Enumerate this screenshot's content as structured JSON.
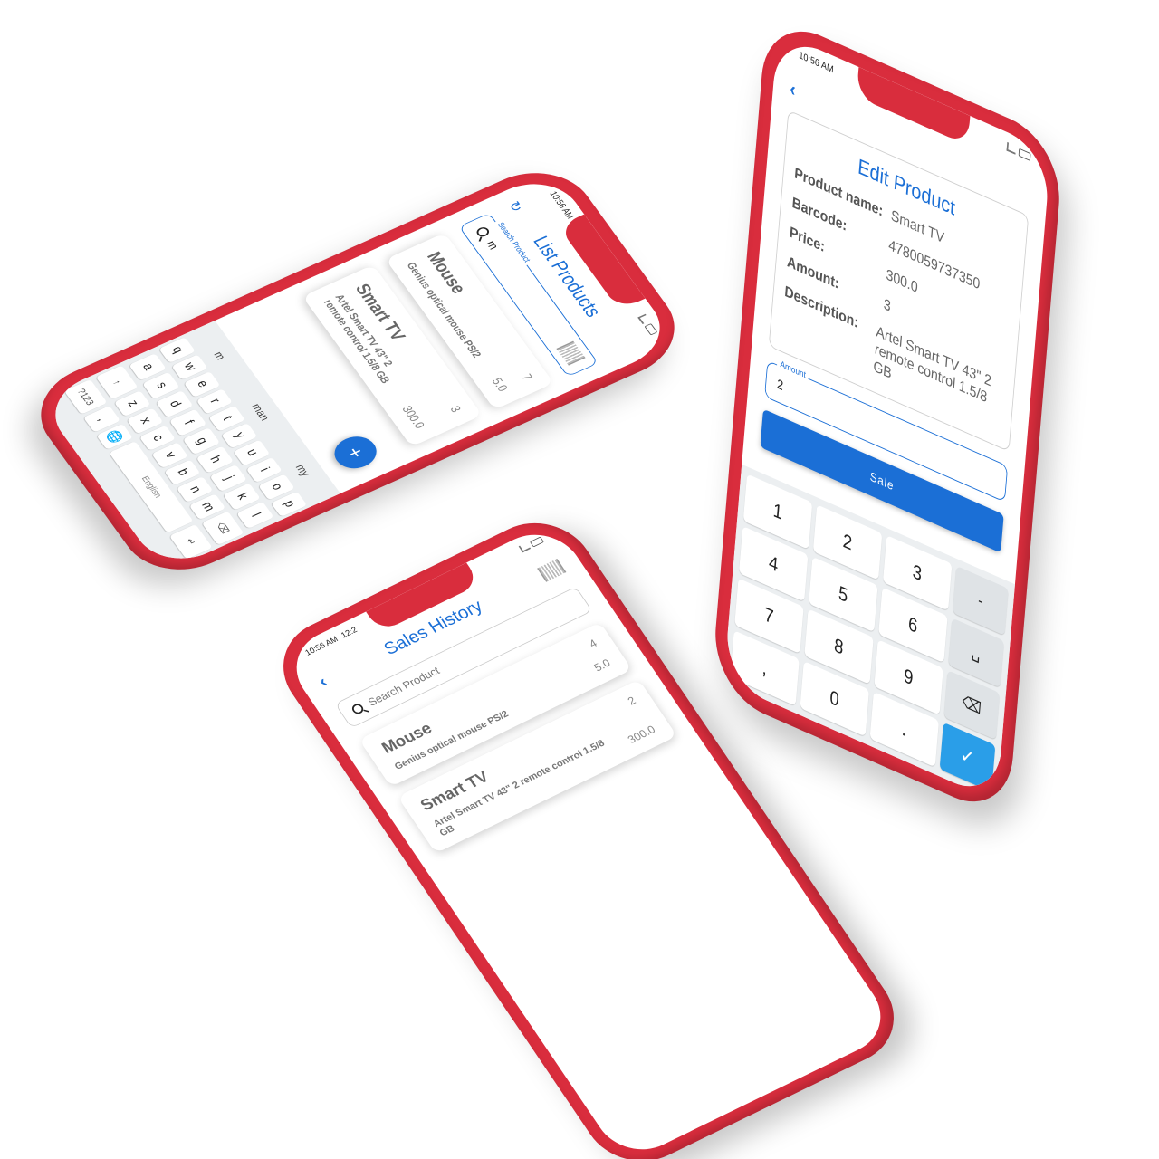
{
  "status": {
    "time": "10:56 AM",
    "extra": "12:2"
  },
  "list_products": {
    "title": "List Products",
    "search_label": "Search Product",
    "search_value": "m",
    "items": [
      {
        "name": "Mouse",
        "desc": "Genius optical mouse PS/2",
        "qty": "7",
        "price": "5.0"
      },
      {
        "name": "Smart TV",
        "desc": "Artel Smart TV 43\" 2 remote control 1.5/8 GB",
        "qty": "3",
        "price": "300.0"
      }
    ],
    "fab": "+",
    "keyboard": {
      "suggestions": [
        "m",
        "man",
        "my"
      ],
      "row1": [
        "q",
        "w",
        "e",
        "r",
        "t",
        "y",
        "u",
        "i",
        "o",
        "p"
      ],
      "row2": [
        "a",
        "s",
        "d",
        "f",
        "g",
        "h",
        "j",
        "k",
        "l"
      ],
      "row3": [
        "z",
        "x",
        "c",
        "v",
        "b",
        "n",
        "m"
      ],
      "shift": "↑",
      "backspace": "⌫",
      "num_key": "?123",
      "comma": ",",
      "globe": "🌐",
      "space": "English",
      "enter": "↵"
    }
  },
  "sales_history": {
    "title": "Sales History",
    "search_placeholder": "Search Product",
    "items": [
      {
        "name": "Mouse",
        "desc": "Genius optical mouse PS/2",
        "qty": "4",
        "price": "5.0"
      },
      {
        "name": "Smart TV",
        "desc": "Artel Smart TV 43\" 2 remote control 1.5/8 GB",
        "qty": "2",
        "price": "300.0"
      }
    ]
  },
  "edit_product": {
    "title": "Edit Product",
    "fields": [
      {
        "label": "Product name:",
        "value": "Smart TV"
      },
      {
        "label": "Barcode:",
        "value": "4780059737350"
      },
      {
        "label": "Price:",
        "value": "300.0"
      },
      {
        "label": "Amount:",
        "value": "3"
      },
      {
        "label": "Description:",
        "value": "Artel Smart TV 43\" 2 remote control 1.5/8 GB"
      }
    ],
    "amount_label": "Amount",
    "amount_value": "2",
    "sale_label": "Sale",
    "numpad": [
      "1",
      "2",
      "3",
      "-",
      "4",
      "5",
      "6",
      "␣",
      "7",
      "8",
      "9",
      "⌫",
      ",",
      "0",
      ".",
      "✓"
    ]
  }
}
